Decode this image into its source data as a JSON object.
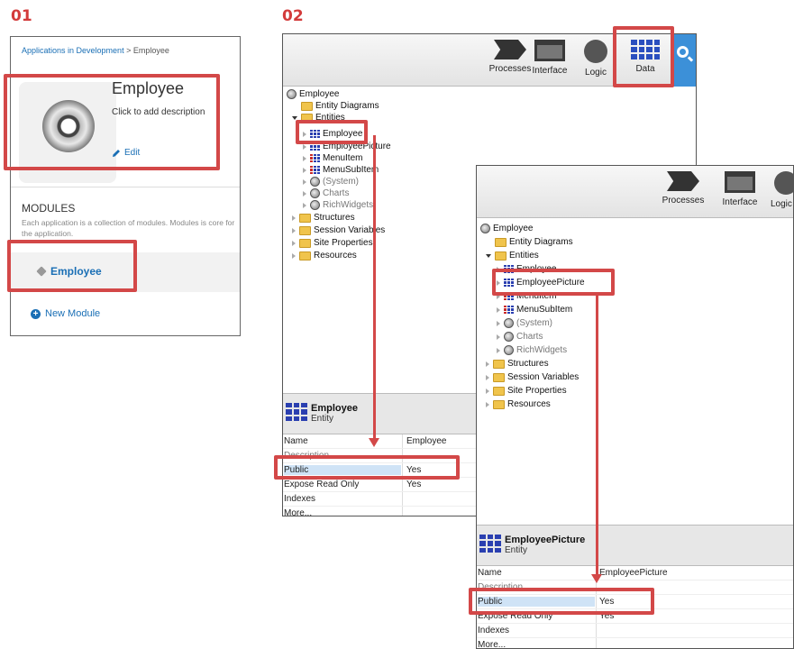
{
  "steps": {
    "one": "01",
    "two": "02"
  },
  "panel1": {
    "breadcrumb_link": "Applications in Development",
    "breadcrumb_sep": " > ",
    "breadcrumb_current": "Employee",
    "app_title": "Employee",
    "app_description": "Click to add description",
    "edit_label": "Edit",
    "modules_heading": "MODULES",
    "modules_note": "Each application is a collection of modules. Modules is core for the application.",
    "module_name": "Employee",
    "new_module_label": "New Module"
  },
  "window_a": {
    "toolbar": [
      "Processes",
      "Interface",
      "Logic",
      "Data"
    ],
    "tree": {
      "root": "Employee",
      "entity_diagrams": "Entity Diagrams",
      "entities": "Entities",
      "entities_items": [
        "Employee",
        "EmployeePicture",
        "MenuItem",
        "MenuSubItem"
      ],
      "system_items": [
        "(System)",
        "Charts",
        "RichWidgets"
      ],
      "folders": [
        "Structures",
        "Session Variables",
        "Site Properties",
        "Resources"
      ]
    },
    "props": {
      "title": "Employee",
      "subtitle": "Entity",
      "rows": [
        {
          "key": "Name",
          "value": "Employee"
        },
        {
          "key": "Description",
          "value": ""
        },
        {
          "key": "Public",
          "value": "Yes"
        },
        {
          "key": "Expose Read Only",
          "value": "Yes"
        },
        {
          "key": "Indexes",
          "value": ""
        },
        {
          "key": "More...",
          "value": ""
        }
      ]
    }
  },
  "window_b": {
    "toolbar": [
      "Processes",
      "Interface",
      "Logic"
    ],
    "tree": {
      "root": "Employee",
      "entity_diagrams": "Entity Diagrams",
      "entities": "Entities",
      "entities_items": [
        "Employee",
        "EmployeePicture",
        "MenuItem",
        "MenuSubItem"
      ],
      "system_items": [
        "(System)",
        "Charts",
        "RichWidgets"
      ],
      "folders": [
        "Structures",
        "Session Variables",
        "Site Properties",
        "Resources"
      ]
    },
    "props": {
      "title": "EmployeePicture",
      "subtitle": "Entity",
      "rows": [
        {
          "key": "Name",
          "value": "EmployeePicture"
        },
        {
          "key": "Description",
          "value": ""
        },
        {
          "key": "Public",
          "value": "Yes"
        },
        {
          "key": "Expose Read Only",
          "value": "Yes"
        },
        {
          "key": "Indexes",
          "value": ""
        },
        {
          "key": "More...",
          "value": ""
        }
      ]
    }
  },
  "colors": {
    "annotation": "#d34848",
    "link": "#1a6fb5",
    "accent": "#3c90d8"
  }
}
